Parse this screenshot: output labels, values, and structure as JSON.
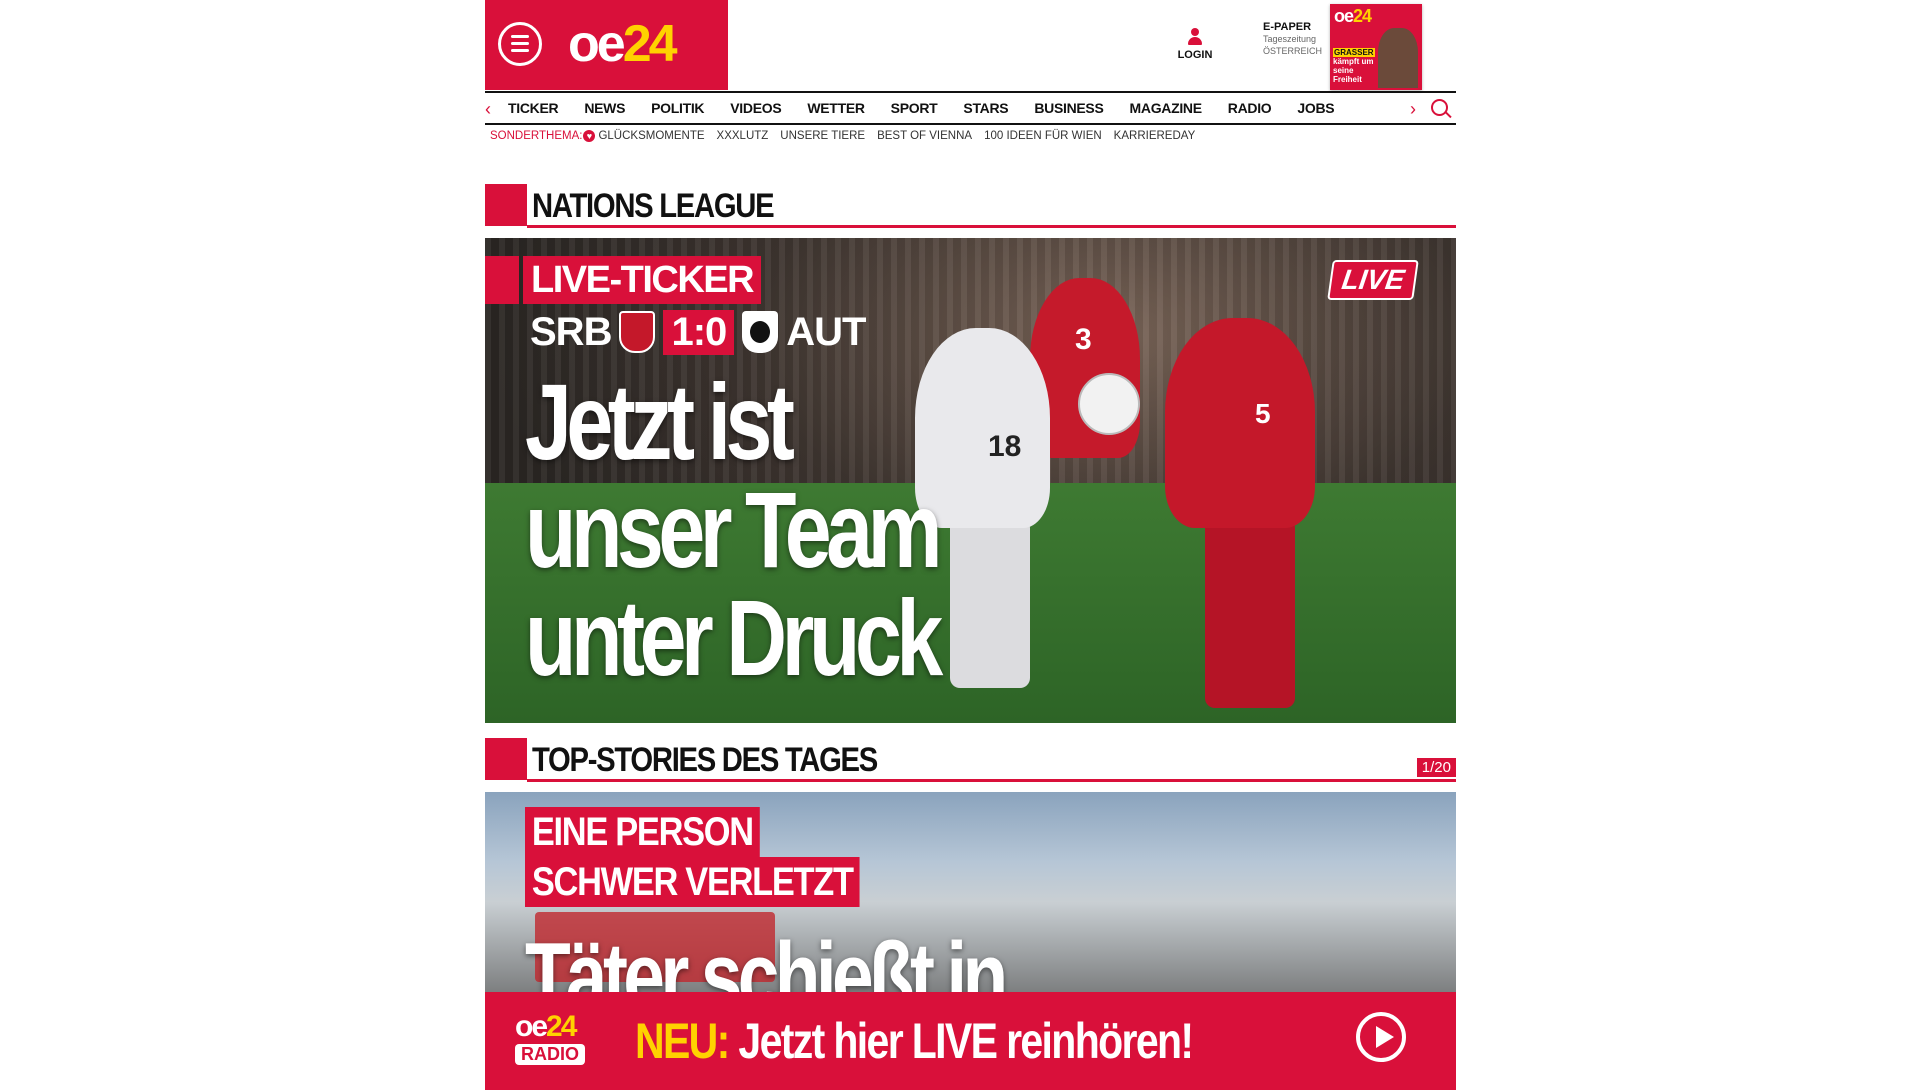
{
  "header": {
    "logo_main": "oe",
    "logo_num": "24",
    "login_label": "LOGIN",
    "epaper": {
      "title": "E-PAPER",
      "line1": "Tageszeitung",
      "line2": "ÖSTERREICH"
    },
    "cover": {
      "logo_main": "oe",
      "logo_num": "24",
      "headline_tag": "GRASSER",
      "headline": "kämpft um seine Freiheit"
    }
  },
  "nav": {
    "items": [
      "TICKER",
      "NEWS",
      "POLITIK",
      "VIDEOS",
      "WETTER",
      "SPORT",
      "STARS",
      "BUSINESS",
      "MAGAZINE",
      "RADIO",
      "JOBS"
    ],
    "left_arrow": "‹",
    "right_arrow": "›"
  },
  "subnav": {
    "lead": "SONDERTHEMA:",
    "items": [
      "GLÜCKSMOMENTE",
      "XXXLUTZ",
      "UNSERE TIERE",
      "BEST OF VIENNA",
      "100 IDEEN FÜR WIEN",
      "KARRIEREDAY"
    ]
  },
  "sections": {
    "nations": "NATIONS LEAGUE",
    "top": "TOP-STORIES DES TAGES",
    "counter": "1/20"
  },
  "hero": {
    "tag": "LIVE-TICKER",
    "team_home": "SRB",
    "score": "1:0",
    "team_away": "AUT",
    "live": "LIVE",
    "headline_1": "Jetzt ist",
    "headline_2": "unser Team",
    "headline_3": "unter Druck",
    "jersey_18": "18",
    "jersey_3": "3",
    "jersey_5": "5"
  },
  "story2": {
    "tag1": "EINE PERSON",
    "tag2": "SCHWER VERLETZT",
    "headline": "Täter schießt in"
  },
  "radio": {
    "logo_main": "oe",
    "logo_num": "24",
    "logo_sub": "RADIO",
    "new": "NEU:",
    "text": " Jetzt hier LIVE reinhören!"
  }
}
